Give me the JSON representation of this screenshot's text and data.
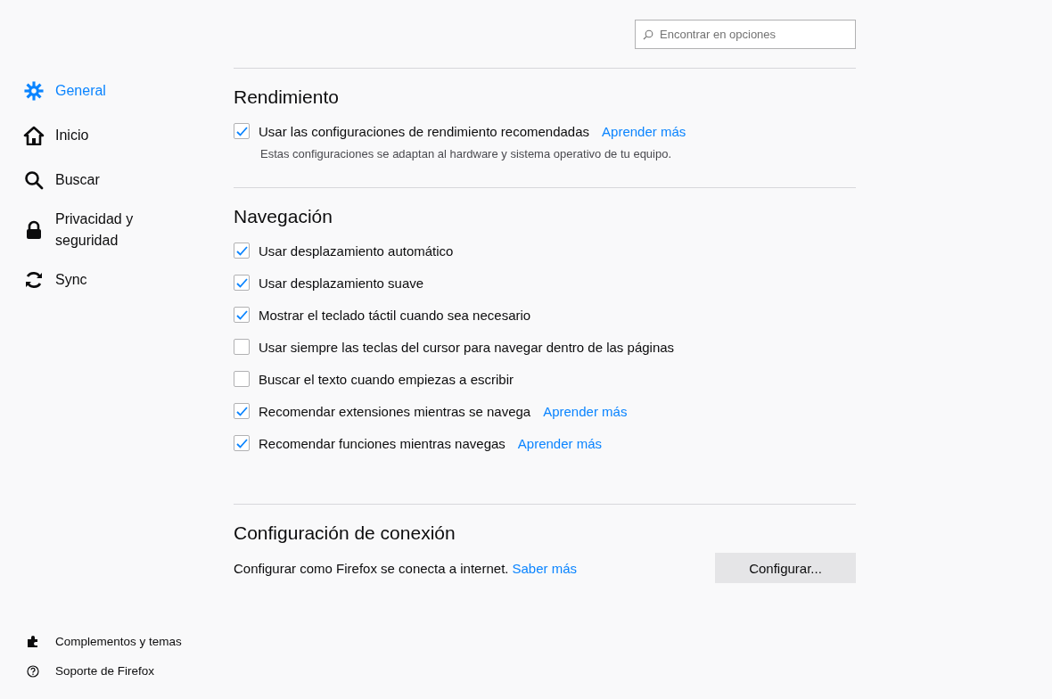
{
  "search": {
    "placeholder": "Encontrar en opciones"
  },
  "nav": [
    {
      "label": "General",
      "selected": true
    },
    {
      "label": "Inicio",
      "selected": false
    },
    {
      "label": "Buscar",
      "selected": false
    },
    {
      "label": "Privacidad y seguridad",
      "selected": false
    },
    {
      "label": "Sync",
      "selected": false
    }
  ],
  "footer_links": [
    {
      "label": "Complementos y temas"
    },
    {
      "label": "Soporte de Firefox"
    }
  ],
  "performance": {
    "title": "Rendimiento",
    "options": [
      {
        "label": "Usar las configuraciones de rendimiento recomendadas",
        "checked": true,
        "link": "Aprender más"
      }
    ],
    "note": "Estas configuraciones se adaptan al hardware y sistema operativo de tu equipo."
  },
  "navigation": {
    "title": "Navegación",
    "options": [
      {
        "label": "Usar desplazamiento automático",
        "checked": true
      },
      {
        "label": "Usar desplazamiento suave",
        "checked": true
      },
      {
        "label": "Mostrar el teclado táctil cuando sea necesario",
        "checked": true
      },
      {
        "label": "Usar siempre las teclas del cursor para navegar dentro de las páginas",
        "checked": false
      },
      {
        "label": "Buscar el texto cuando empiezas a escribir",
        "checked": false
      },
      {
        "label": "Recomendar extensiones mientras se navega",
        "checked": true,
        "link": "Aprender más"
      },
      {
        "label": "Recomendar funciones mientras navegas",
        "checked": true,
        "link": "Aprender más"
      }
    ]
  },
  "connection": {
    "title": "Configuración de conexión",
    "text": "Configurar como Firefox se conecta a internet.",
    "link": "Saber más",
    "button": "Configurar..."
  }
}
